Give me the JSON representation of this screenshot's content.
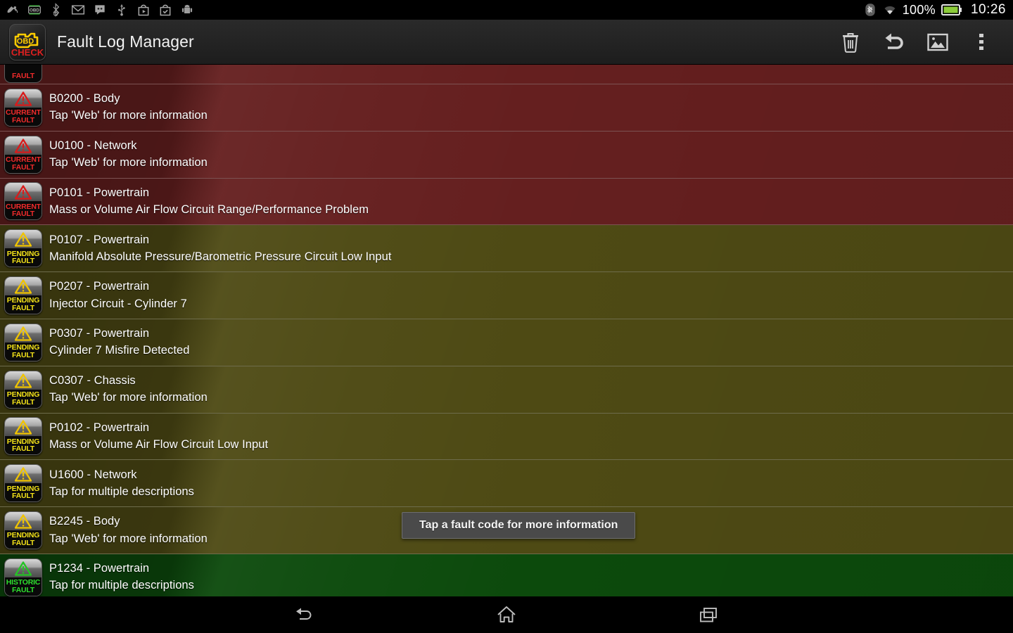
{
  "statusbar": {
    "left_icons": [
      {
        "name": "satellite-icon"
      },
      {
        "name": "obd-icon"
      },
      {
        "name": "bluetooth-device-icon"
      },
      {
        "name": "gmail-icon"
      },
      {
        "name": "hangouts-icon"
      },
      {
        "name": "usb-icon"
      },
      {
        "name": "play-store-icon"
      },
      {
        "name": "tasks-icon"
      },
      {
        "name": "android-icon"
      }
    ],
    "bluetooth": "bluetooth-icon",
    "wifi": "wifi-icon",
    "battery_percent": "100%",
    "battery_icon": "battery-full-icon",
    "time": "10:26"
  },
  "actionbar": {
    "app_icon_top": "OBD",
    "app_icon_bottom": "CHECK",
    "title": "Fault Log Manager",
    "buttons": [
      {
        "name": "delete-button",
        "icon": "trash-icon",
        "label": "Delete"
      },
      {
        "name": "undo-button",
        "icon": "undo-arrow-icon",
        "label": "Undo"
      },
      {
        "name": "screenshot-button",
        "icon": "image-icon",
        "label": "Image"
      },
      {
        "name": "overflow-menu-button",
        "icon": "more-vertical-icon",
        "label": "More options"
      }
    ]
  },
  "list": {
    "clipped_top_row": {
      "badge_line2": "FAULT",
      "severity": "current"
    },
    "rows": [
      {
        "code": "B0200 - Body",
        "description": "Tap 'Web' for more information",
        "severity": "current",
        "badge_line1": "CURRENT",
        "badge_line2": "FAULT"
      },
      {
        "code": "U0100 - Network",
        "description": "Tap 'Web' for more information",
        "severity": "current",
        "badge_line1": "CURRENT",
        "badge_line2": "FAULT"
      },
      {
        "code": "P0101 - Powertrain",
        "description": "Mass or Volume Air Flow Circuit Range/Performance Problem",
        "severity": "current",
        "badge_line1": "CURRENT",
        "badge_line2": "FAULT"
      },
      {
        "code": "P0107 - Powertrain",
        "description": "Manifold Absolute Pressure/Barometric Pressure Circuit Low Input",
        "severity": "pending",
        "badge_line1": "PENDING",
        "badge_line2": "FAULT"
      },
      {
        "code": "P0207 - Powertrain",
        "description": "Injector Circuit - Cylinder 7",
        "severity": "pending",
        "badge_line1": "PENDING",
        "badge_line2": "FAULT"
      },
      {
        "code": "P0307 - Powertrain",
        "description": "Cylinder 7 Misfire Detected",
        "severity": "pending",
        "badge_line1": "PENDING",
        "badge_line2": "FAULT"
      },
      {
        "code": "C0307 - Chassis",
        "description": "Tap 'Web' for more information",
        "severity": "pending",
        "badge_line1": "PENDING",
        "badge_line2": "FAULT"
      },
      {
        "code": "P0102 - Powertrain",
        "description": "Mass or Volume Air Flow Circuit Low Input",
        "severity": "pending",
        "badge_line1": "PENDING",
        "badge_line2": "FAULT"
      },
      {
        "code": "U1600 - Network",
        "description": "Tap for multiple descriptions",
        "severity": "pending",
        "badge_line1": "PENDING",
        "badge_line2": "FAULT"
      },
      {
        "code": "B2245 - Body",
        "description": "Tap 'Web' for more information",
        "severity": "pending",
        "badge_line1": "PENDING",
        "badge_line2": "FAULT"
      },
      {
        "code": "P1234 - Powertrain",
        "description": "Tap for multiple descriptions",
        "severity": "historic",
        "badge_line1": "HISTORIC",
        "badge_line2": "FAULT"
      }
    ]
  },
  "toast": {
    "message": "Tap a fault code for more information"
  },
  "navbar": {
    "back": "back-icon",
    "home": "home-icon",
    "recents": "recents-icon"
  },
  "colors": {
    "current_row": "#651f1f",
    "pending_row": "#4e4a14",
    "historic_row": "#0c4a0c",
    "actionbar": "#242424",
    "current_text": "#ef2b2b",
    "pending_text": "#f2e119",
    "historic_text": "#2ee02e",
    "app_icon_obd": "#ffcc00",
    "app_icon_check": "#e02020"
  }
}
